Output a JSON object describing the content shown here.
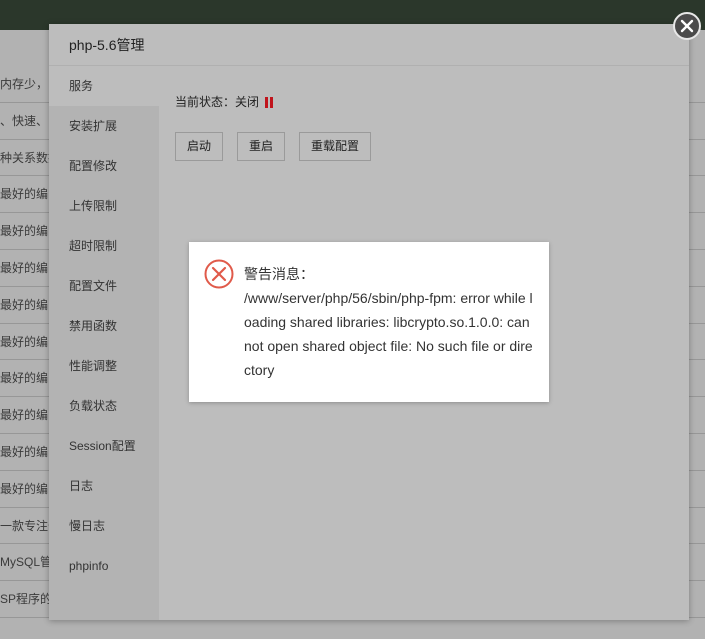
{
  "modal": {
    "title": "php-5.6管理"
  },
  "sidebar": {
    "items": [
      {
        "label": "服务"
      },
      {
        "label": "安装扩展"
      },
      {
        "label": "配置修改"
      },
      {
        "label": "上传限制"
      },
      {
        "label": "超时限制"
      },
      {
        "label": "配置文件"
      },
      {
        "label": "禁用函数"
      },
      {
        "label": "性能调整"
      },
      {
        "label": "负载状态"
      },
      {
        "label": "Session配置"
      },
      {
        "label": "日志"
      },
      {
        "label": "慢日志"
      },
      {
        "label": "phpinfo"
      }
    ]
  },
  "service": {
    "status_label": "当前状态：",
    "status_value": "关闭",
    "buttons": {
      "start": "启动",
      "restart": "重启",
      "reload": "重载配置"
    }
  },
  "alert": {
    "title": "警告消息：",
    "message": "/www/server/php/56/sbin/php-fpm: error while loading shared libraries: libcrypto.so.1.0.0: cannot open shared object file: No such file or directory"
  },
  "background_rows": [
    "内存少，",
    "、快速、",
    "种关系数据",
    "最好的编",
    "最好的编",
    "最好的编",
    "最好的编",
    "最好的编",
    "最好的编",
    "最好的编",
    "最好的编",
    "最好的编",
    "一款专注于",
    "MySQL管理",
    "SP程序的运"
  ],
  "colors": {
    "status_stopped": "#c0141c",
    "alert_icon": "#e05a4a"
  }
}
